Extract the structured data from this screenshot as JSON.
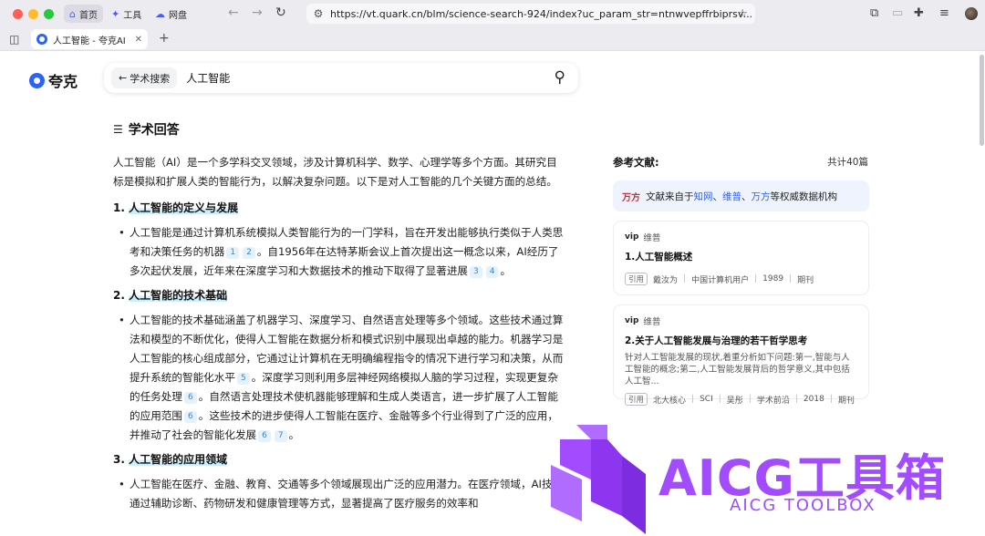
{
  "browser": {
    "pills": [
      {
        "icon": "home-icon",
        "label": "首页"
      },
      {
        "icon": "tools-icon",
        "label": "工具"
      },
      {
        "icon": "cloud-icon",
        "label": "网盘"
      }
    ],
    "url": "https://vt.quark.cn/blm/science-search-924/index?uc_param_str=ntnwvepffrbiprsv...",
    "tab_title": "人工智能 - 夸克AI"
  },
  "header": {
    "logo_text": "夸克",
    "back_label": "学术搜索",
    "query": "人工智能"
  },
  "answer": {
    "title": "学术回答",
    "intro": "人工智能（AI）是一个多学科交叉领域，涉及计算机科学、数学、心理学等多个方面。其研究目标是模拟和扩展人类的智能行为，以解决复杂问题。以下是对人工智能的几个关键方面的总结。",
    "sections": [
      {
        "num": "1.",
        "heading": "人工智能的定义与发展",
        "parts": [
          {
            "text": "人工智能是通过计算机系统模拟人类智能行为的一门学科，旨在开发出能够执行类似于人类思考和决策任务的机器"
          },
          {
            "refs": [
              "1",
              "2"
            ]
          },
          {
            "text": "。自1956年在达特茅斯会议上首次提出这一概念以来，AI经历了多次起伏发展，近年来在深度学习和大数据技术的推动下取得了显著进展"
          },
          {
            "refs": [
              "3",
              "4"
            ]
          },
          {
            "text": "。"
          }
        ]
      },
      {
        "num": "2.",
        "heading": "人工智能的技术基础",
        "parts": [
          {
            "text": "人工智能的技术基础涵盖了机器学习、深度学习、自然语言处理等多个领域。这些技术通过算法和模型的不断优化，使得人工智能在数据分析和模式识别中展现出卓越的能力。机器学习是人工智能的核心组成部分，它通过让计算机在无明确编程指令的情况下进行学习和决策，从而提升系统的智能化水平"
          },
          {
            "refs": [
              "5"
            ]
          },
          {
            "text": "。深度学习则利用多层神经网络模拟人脑的学习过程，实现更复杂的任务处理"
          },
          {
            "refs": [
              "6"
            ]
          },
          {
            "text": "。自然语言处理技术使机器能够理解和生成人类语言，进一步扩展了人工智能的应用范围"
          },
          {
            "refs": [
              "6"
            ]
          },
          {
            "text": "。这些技术的进步使得人工智能在医疗、金融等多个行业得到了广泛的应用，并推动了社会的智能化发展"
          },
          {
            "refs": [
              "6",
              "7"
            ]
          },
          {
            "text": "。"
          }
        ]
      },
      {
        "num": "3.",
        "heading": "人工智能的应用领域",
        "parts": [
          {
            "text": "人工智能在医疗、金融、教育、交通等多个领域展现出广泛的应用潜力。在医疗领域，AI技术通过辅助诊断、药物研发和健康管理等方式，显著提高了医疗服务的效率和"
          }
        ]
      }
    ]
  },
  "references": {
    "label": "参考文献:",
    "count": "共计40篇",
    "source_logo": "万方",
    "source_prefix": "文献来自于",
    "source_1": "知网",
    "source_sep": "、",
    "source_2": "维普",
    "source_3": "万方",
    "source_suffix": "等权威数据机构",
    "cards": [
      {
        "source": "维普",
        "title": "1.人工智能概述",
        "snippet": "",
        "tag": "引用",
        "meta": [
          "戴汝为",
          "中国计算机用户",
          "1989",
          "期刊"
        ]
      },
      {
        "source": "维普",
        "title": "2.关于人工智能发展与治理的若干哲学思考",
        "snippet": "针对人工智能发展的现状,着重分析如下问题:第一,智能与人工智能的概念;第二,人工智能发展背后的哲学意义,其中包括人工智...",
        "tag": "引用",
        "meta": [
          "北大核心",
          "SCI",
          "吴彤",
          "学术前沿",
          "2018",
          "期刊"
        ]
      }
    ]
  },
  "watermark": {
    "text": "AICG工具箱",
    "sub": "AICG TOOLBOX",
    "color": "#a24bff"
  }
}
